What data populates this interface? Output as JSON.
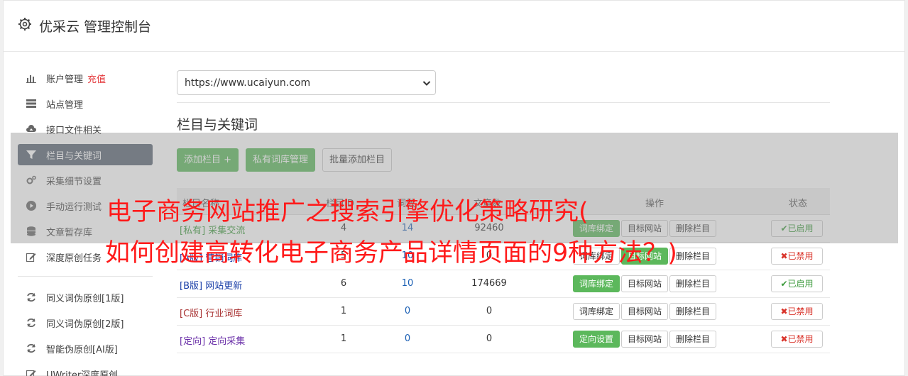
{
  "header": {
    "title": "优采云 管理控制台",
    "icon": "gear-icon"
  },
  "sidebar": {
    "items": [
      {
        "label": "账户管理",
        "extra": "充值",
        "icon": "bar-chart-icon"
      },
      {
        "label": "站点管理",
        "icon": "server-icon"
      },
      {
        "label": "接口文件相关",
        "icon": "cloud-upload-icon"
      },
      {
        "label": "栏目与关键词",
        "icon": "filter-icon",
        "active": true
      },
      {
        "label": "采集细节设置",
        "icon": "cogs-icon"
      },
      {
        "label": "手动运行测试",
        "icon": "play-circle-icon"
      },
      {
        "label": "文章暂存库",
        "icon": "database-icon"
      },
      {
        "label": "深度原创任务",
        "icon": "edit-icon"
      }
    ],
    "items2": [
      {
        "label": "同义词伪原创[1版]",
        "icon": "refresh-icon"
      },
      {
        "label": "同义词伪原创[2版]",
        "icon": "refresh-icon"
      },
      {
        "label": "智能伪原创[AI版]",
        "icon": "refresh-icon"
      },
      {
        "label": "UWriter深度原创",
        "icon": "edit-icon"
      }
    ]
  },
  "main": {
    "site_select": "https://www.ucaiyun.com",
    "section_title": "栏目与关键词",
    "buttons": {
      "add": "添加栏目 +",
      "private": "私有词库管理",
      "batch": "批量添加栏目"
    },
    "table": {
      "headers": {
        "name": "栏目名称",
        "id": "栏目ID",
        "words": "词数",
        "articles": "文章数",
        "ops": "操作",
        "status": "状态"
      },
      "rows": [
        {
          "tag": "[私有]",
          "name": "采集交流",
          "id": "4",
          "words": "14",
          "articles": "92460",
          "op1": "词库绑定",
          "op2": "目标网站",
          "op3": "删除栏目",
          "status": "✔已启用",
          "on": true
        },
        {
          "tag": "[A版]",
          "name": "营销词库",
          "id": "5",
          "words": "10",
          "articles": "0",
          "op1": "词库绑定",
          "op2": "目标网站",
          "op3": "删除栏目",
          "status": "✖已禁用",
          "on": false
        },
        {
          "tag": "[B版]",
          "name": "网站更新",
          "id": "6",
          "words": "10",
          "articles": "174669",
          "op1": "词库绑定",
          "op2": "目标网站",
          "op3": "删除栏目",
          "status": "✔已启用",
          "on": true
        },
        {
          "tag": "[C版]",
          "name": "行业词库",
          "id": "1",
          "words": "0",
          "articles": "0",
          "op1": "词库绑定",
          "op2": "目标网站",
          "op3": "删除栏目",
          "status": "✖已禁用",
          "on": false
        },
        {
          "tag": "[定向]",
          "name": "定向采集",
          "id": "1",
          "words": "0",
          "articles": "0",
          "op1": "定向设置",
          "op2": "目标网站",
          "op3": "删除栏目",
          "status": "✖已禁用",
          "on": false
        }
      ]
    }
  },
  "overlay": {
    "line1": "电子商务网站推广之搜索引擎优化策略研究(",
    "line2": "如何创建高转化电子商务产品详情页面的9种方法？)"
  },
  "colors": {
    "accent": "#5cb85c",
    "headline": "#ff1a1a",
    "active_nav": "#5a6474"
  }
}
